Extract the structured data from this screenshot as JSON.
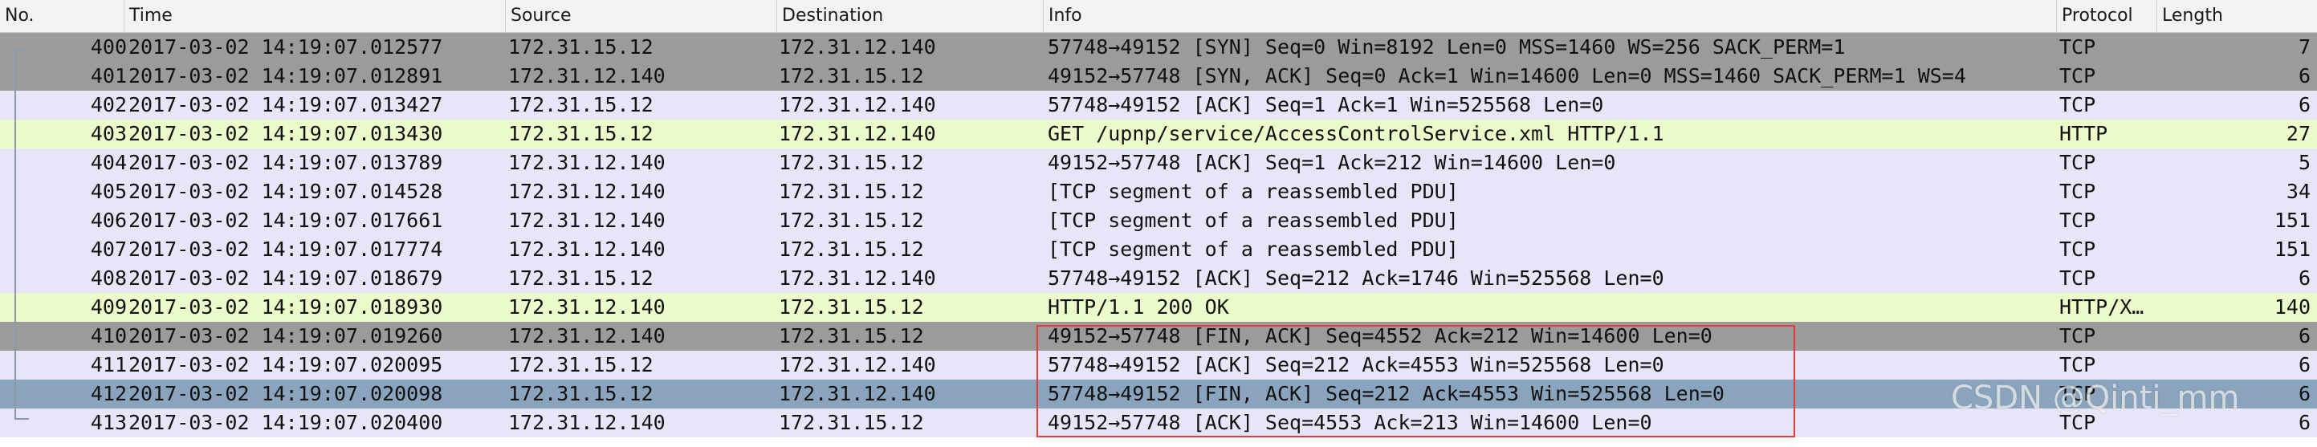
{
  "columns": {
    "no": "No.",
    "time": "Time",
    "source": "Source",
    "destination": "Destination",
    "info": "Info",
    "protocol": "Protocol",
    "length": "Length"
  },
  "packets": [
    {
      "no": "400",
      "time": "2017-03-02 14:19:07.012577",
      "source": "172.31.15.12",
      "destination": "172.31.12.140",
      "info": "57748→49152 [SYN] Seq=0 Win=8192 Len=0 MSS=1460 WS=256 SACK_PERM=1",
      "protocol": "TCP",
      "length": "7"
    },
    {
      "no": "401",
      "time": "2017-03-02 14:19:07.012891",
      "source": "172.31.12.140",
      "destination": "172.31.15.12",
      "info": "49152→57748 [SYN, ACK] Seq=0 Ack=1 Win=14600 Len=0 MSS=1460 SACK_PERM=1 WS=4",
      "protocol": "TCP",
      "length": "6"
    },
    {
      "no": "402",
      "time": "2017-03-02 14:19:07.013427",
      "source": "172.31.15.12",
      "destination": "172.31.12.140",
      "info": "57748→49152 [ACK] Seq=1 Ack=1 Win=525568 Len=0",
      "protocol": "TCP",
      "length": "6"
    },
    {
      "no": "403",
      "time": "2017-03-02 14:19:07.013430",
      "source": "172.31.15.12",
      "destination": "172.31.12.140",
      "info": "GET /upnp/service/AccessControlService.xml HTTP/1.1",
      "protocol": "HTTP",
      "length": "27"
    },
    {
      "no": "404",
      "time": "2017-03-02 14:19:07.013789",
      "source": "172.31.12.140",
      "destination": "172.31.15.12",
      "info": "49152→57748 [ACK] Seq=1 Ack=212 Win=14600 Len=0",
      "protocol": "TCP",
      "length": "5"
    },
    {
      "no": "405",
      "time": "2017-03-02 14:19:07.014528",
      "source": "172.31.12.140",
      "destination": "172.31.15.12",
      "info": "[TCP segment of a reassembled PDU]",
      "protocol": "TCP",
      "length": "34"
    },
    {
      "no": "406",
      "time": "2017-03-02 14:19:07.017661",
      "source": "172.31.12.140",
      "destination": "172.31.15.12",
      "info": "[TCP segment of a reassembled PDU]",
      "protocol": "TCP",
      "length": "151"
    },
    {
      "no": "407",
      "time": "2017-03-02 14:19:07.017774",
      "source": "172.31.12.140",
      "destination": "172.31.15.12",
      "info": "[TCP segment of a reassembled PDU]",
      "protocol": "TCP",
      "length": "151"
    },
    {
      "no": "408",
      "time": "2017-03-02 14:19:07.018679",
      "source": "172.31.15.12",
      "destination": "172.31.12.140",
      "info": "57748→49152 [ACK] Seq=212 Ack=1746 Win=525568 Len=0",
      "protocol": "TCP",
      "length": "6"
    },
    {
      "no": "409",
      "time": "2017-03-02 14:19:07.018930",
      "source": "172.31.12.140",
      "destination": "172.31.15.12",
      "info": "HTTP/1.1 200 OK",
      "protocol": "HTTP/X…",
      "length": "140"
    },
    {
      "no": "410",
      "time": "2017-03-02 14:19:07.019260",
      "source": "172.31.12.140",
      "destination": "172.31.15.12",
      "info": "49152→57748 [FIN, ACK] Seq=4552 Ack=212 Win=14600 Len=0",
      "protocol": "TCP",
      "length": "6"
    },
    {
      "no": "411",
      "time": "2017-03-02 14:19:07.020095",
      "source": "172.31.15.12",
      "destination": "172.31.12.140",
      "info": "57748→49152 [ACK] Seq=212 Ack=4553 Win=525568 Len=0",
      "protocol": "TCP",
      "length": "6"
    },
    {
      "no": "412",
      "time": "2017-03-02 14:19:07.020098",
      "source": "172.31.15.12",
      "destination": "172.31.12.140",
      "info": "57748→49152 [FIN, ACK] Seq=212 Ack=4553 Win=525568 Len=0",
      "protocol": "TCP",
      "length": "6"
    },
    {
      "no": "413",
      "time": "2017-03-02 14:19:07.020400",
      "source": "172.31.12.140",
      "destination": "172.31.15.12",
      "info": "49152→57748 [ACK] Seq=4553 Ack=213 Win=14600 Len=0",
      "protocol": "TCP",
      "length": "6"
    }
  ],
  "watermark": "CSDN @Qinti_mm",
  "colors": {
    "tcp_row": "#e6e6f8",
    "http_row": "#ebfbca",
    "selected_row": "#9b9b9b",
    "highlighted_row": "#8aa4bd",
    "annotation_box": "#e23b3b"
  }
}
